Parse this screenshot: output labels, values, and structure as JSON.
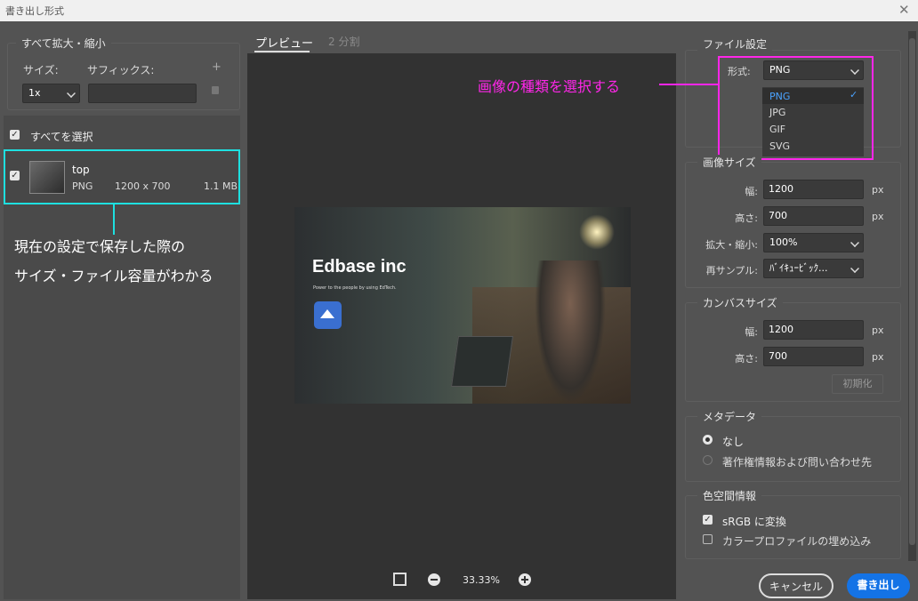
{
  "window": {
    "title": "書き出し形式",
    "close": "✕"
  },
  "left": {
    "scale_all": "すべて拡大・縮小",
    "size_label": "サイズ:",
    "suffix_label": "サフィックス:",
    "plus": "+",
    "scale_value": "1x",
    "suffix_value": "",
    "select_all": "すべてを選択",
    "item": {
      "name": "top",
      "format": "PNG",
      "dimensions": "1200 x 700",
      "file_size": "1.1 MB"
    }
  },
  "annotations": {
    "left_line1": "現在の設定で保存した際の",
    "left_line2": "サイズ・ファイル容量がわかる",
    "right": "画像の種類を選択する"
  },
  "center": {
    "tabs": [
      {
        "label": "プレビュー"
      },
      {
        "label": "2 分割"
      }
    ],
    "preview": {
      "headline": "Edbase inc",
      "tagline": "Power to the people by using EdTech."
    },
    "zoom": "33.33%"
  },
  "right": {
    "file_settings": {
      "legend": "ファイル設定",
      "format_label": "形式:",
      "format_value": "PNG",
      "options": [
        "PNG",
        "JPG",
        "GIF",
        "SVG"
      ],
      "selected": "PNG",
      "behind_text": "j"
    },
    "image_size": {
      "legend": "画像サイズ",
      "width_label": "幅:",
      "width": "1200",
      "height_label": "高さ:",
      "height": "700",
      "unit": "px",
      "scale_label": "拡大・縮小:",
      "scale": "100%",
      "resample_label": "再サンプル:",
      "resample": "ﾊﾞｲｷｭｰﾋﾞｯｸ..."
    },
    "canvas_size": {
      "legend": "カンバスサイズ",
      "width_label": "幅:",
      "width": "1200",
      "height_label": "高さ:",
      "height": "700",
      "unit": "px",
      "reset": "初期化"
    },
    "metadata": {
      "legend": "メタデータ",
      "options": [
        "なし",
        "著作権情報および問い合わせ先"
      ]
    },
    "color_space": {
      "legend": "色空間情報",
      "options": [
        "sRGB に変換",
        "カラープロファイルの埋め込み"
      ]
    }
  },
  "footer": {
    "cancel": "キャンセル",
    "export": "書き出し"
  },
  "colors": {
    "annotation_cyan": "#1ee0e0",
    "annotation_magenta": "#ff26e9",
    "accent": "#1473e6"
  }
}
